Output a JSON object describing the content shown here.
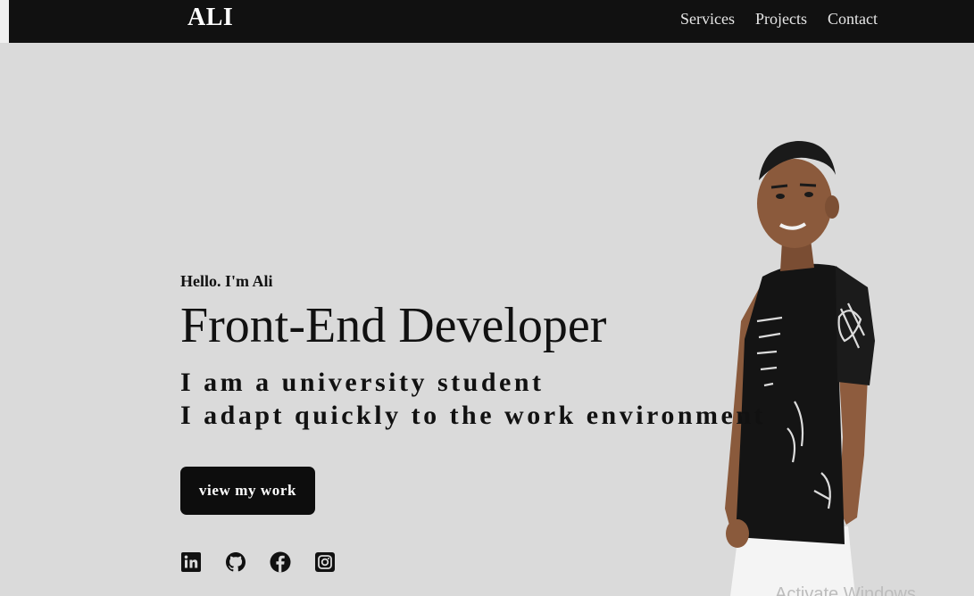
{
  "navbar": {
    "logo": "ALI",
    "links": [
      {
        "label": "Services"
      },
      {
        "label": "Projects"
      },
      {
        "label": "Contact"
      }
    ]
  },
  "hero": {
    "greeting": "Hello. I'm Ali",
    "role": "Front-End Developer",
    "tagline_line1": "I am a university student",
    "tagline_line2": "I adapt quickly to the work environment",
    "cta_label": "view my work"
  },
  "socials": [
    {
      "icon": "linkedin-icon"
    },
    {
      "icon": "github-icon"
    },
    {
      "icon": "facebook-icon"
    },
    {
      "icon": "instagram-icon"
    }
  ],
  "watermark": "Activate Windows",
  "colors": {
    "navbar_bg": "#111111",
    "page_bg": "#dadada",
    "button_bg": "#0d0d0d",
    "text": "#111111"
  }
}
